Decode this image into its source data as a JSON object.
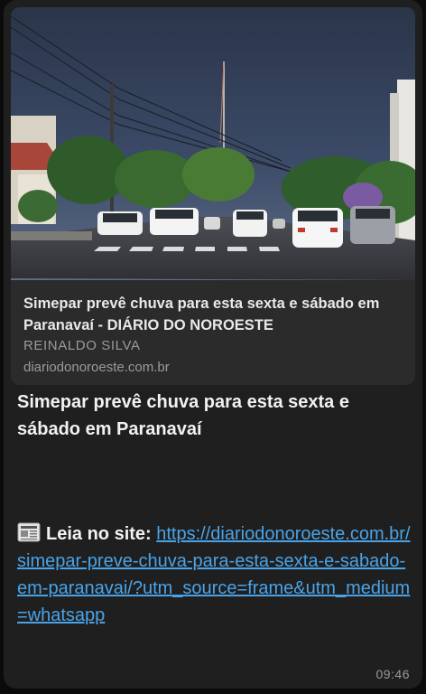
{
  "preview": {
    "title": "Simepar prevê chuva para esta sexta e sábado em Paranavaí - DIÁRIO DO NOROESTE",
    "author": "REINALDO SILVA",
    "domain": "diariodonoroeste.com.br",
    "image_description_icon": "street-photo"
  },
  "message": {
    "title": "Simepar prevê chuva para esta sexta e sábado em Paranavaí",
    "lead_icon": "newspaper-icon",
    "lead_label": "Leia no site",
    "lead_separator": ": ",
    "link_text": "https://diariodonoroeste.com.br/simepar-preve-chuva-para-esta-sexta-e-sabado-em-paranavai/?utm_source=frame&utm_medium=whatsapp",
    "time": "09:46"
  },
  "colors": {
    "bubble": "#1f1f1f",
    "card": "#2b2b2b",
    "link": "#4aa3e8",
    "text": "#f2f2f2",
    "muted": "#9a9a9a"
  }
}
